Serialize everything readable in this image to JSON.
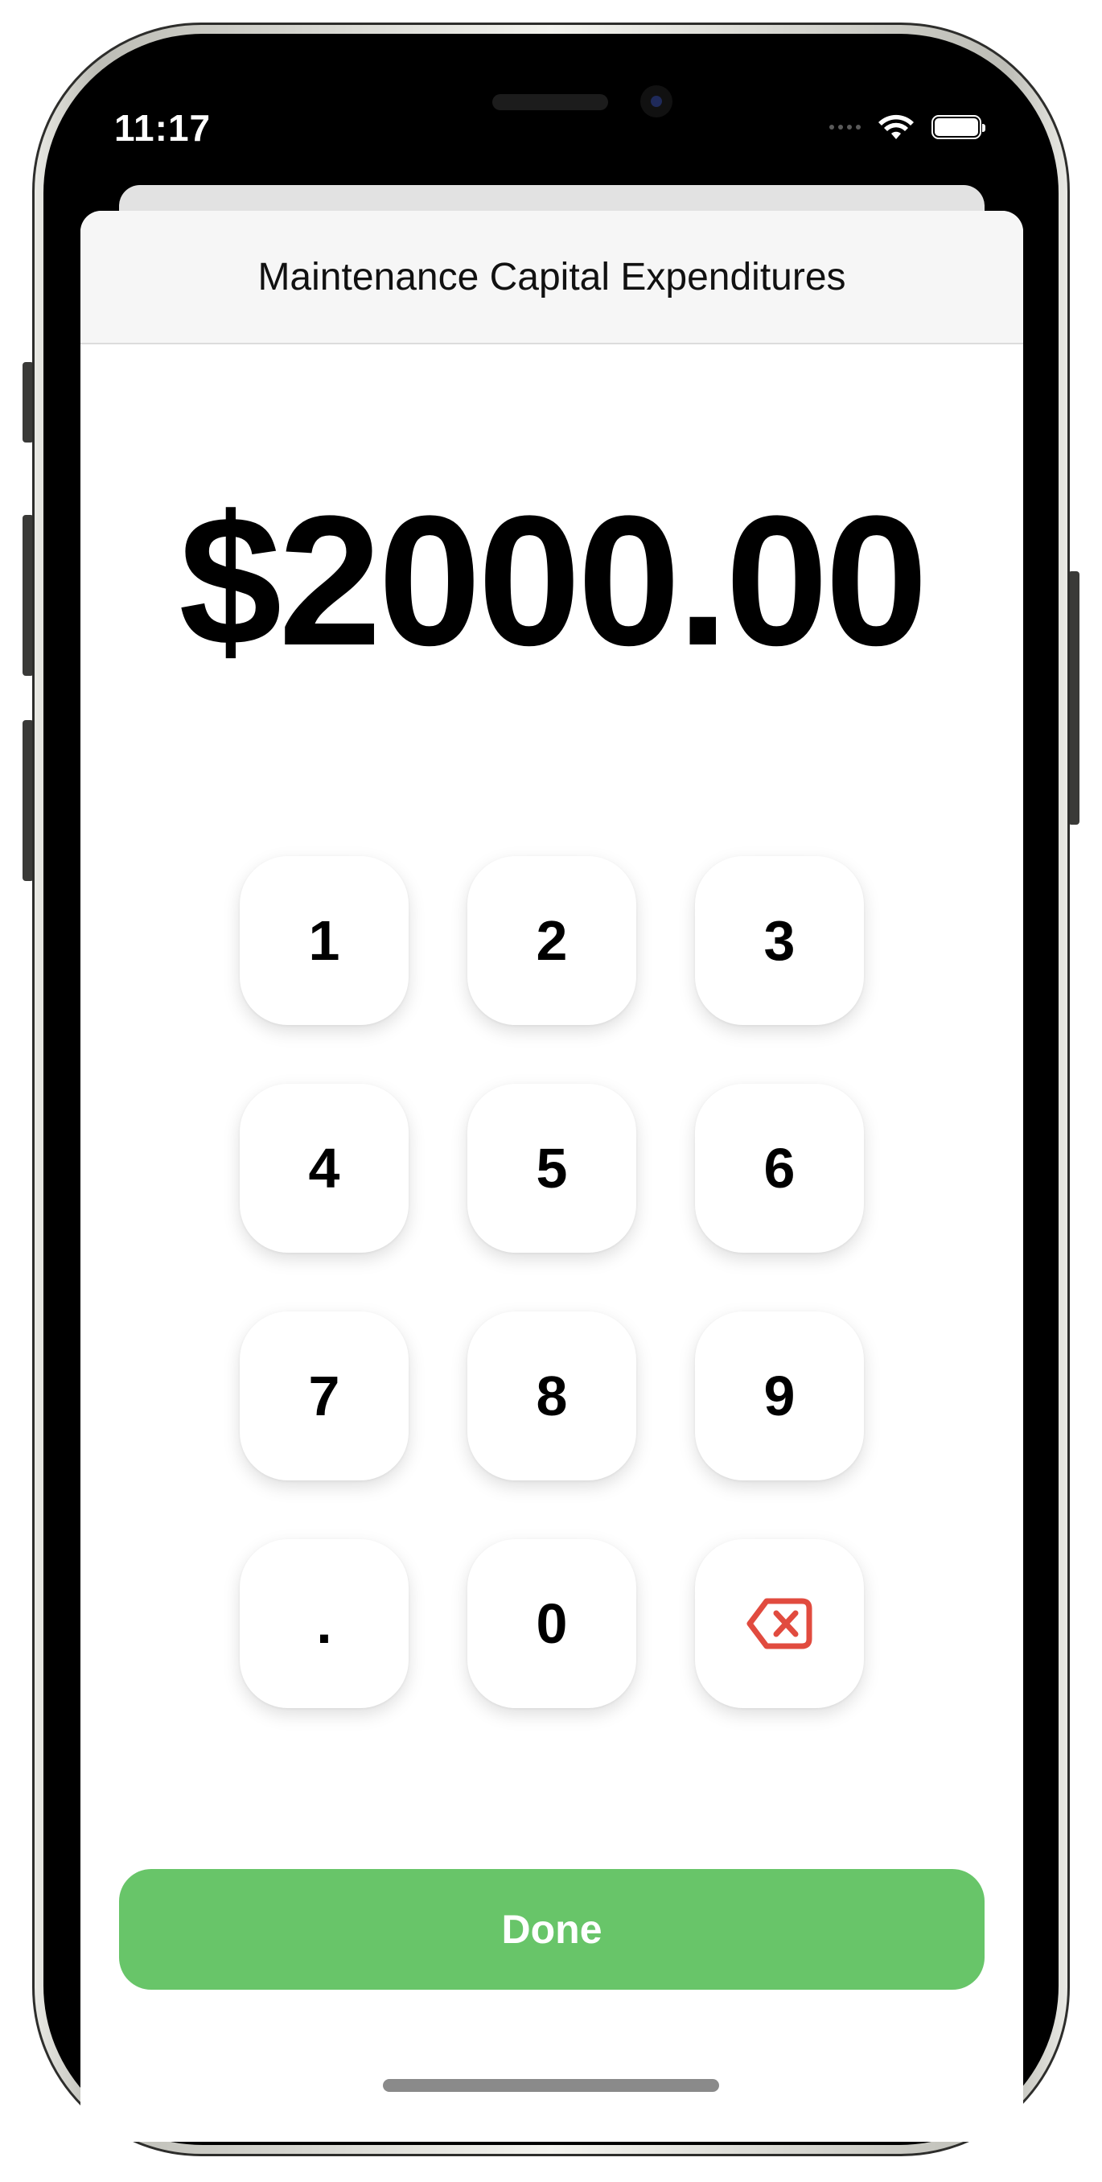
{
  "status_bar": {
    "time": "11:17"
  },
  "sheet": {
    "title": "Maintenance Capital Expenditures"
  },
  "display": {
    "amount": "$2000.00"
  },
  "keypad": {
    "k1": "1",
    "k2": "2",
    "k3": "3",
    "k4": "4",
    "k5": "5",
    "k6": "6",
    "k7": "7",
    "k8": "8",
    "k9": "9",
    "decimal": ".",
    "k0": "0",
    "backspace_icon": "delete-backward-icon"
  },
  "done_label": "Done",
  "colors": {
    "accent_green": "#68c569",
    "backspace_red": "#e14b3f"
  }
}
